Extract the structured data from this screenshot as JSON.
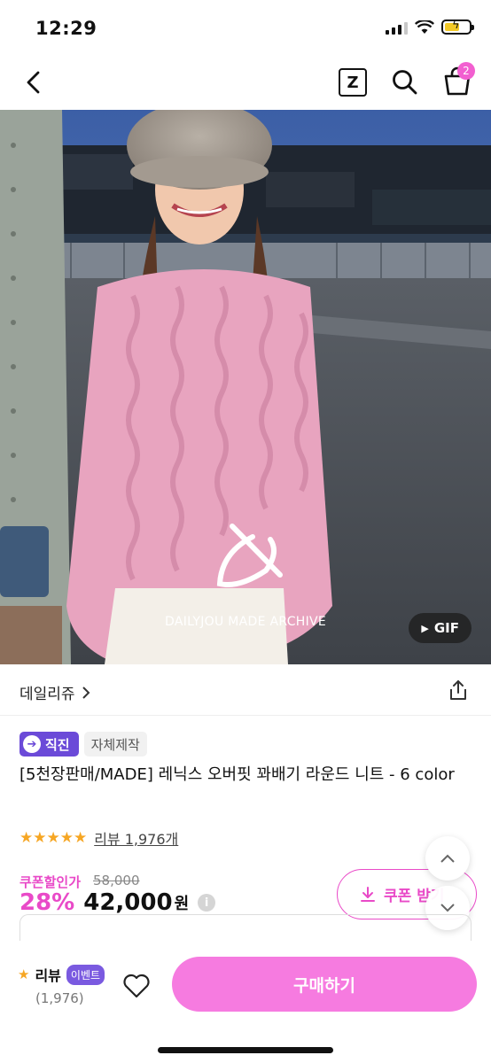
{
  "status_bar": {
    "time": "12:29"
  },
  "nav": {
    "z_label": "Z",
    "cart_count": "2"
  },
  "hero": {
    "watermark": "DAILYJOU MADE ARCHIVE",
    "gif_label": "GIF"
  },
  "product": {
    "brand": "데일리쥬",
    "tag_direct": "직진",
    "tag_made": "자체제작",
    "title": "[5천장판매/MADE] 레닉스 오버핏 꽈배기 라운드 니트 - 6 color",
    "stars": "★★★★★",
    "review_link": "리뷰 1,976개",
    "coupon_label": "쿠폰할인가",
    "original_price": "58,000",
    "discount": "28%",
    "price": "42,000",
    "currency": "원",
    "coupon_button": "쿠폰 받기"
  },
  "bottom": {
    "review_label": "리뷰",
    "event_badge": "이벤트",
    "review_count": "(1,976)",
    "buy_label": "구매하기"
  },
  "colors": {
    "accent": "#e94ac8",
    "buy": "#f67be0",
    "direct_tag": "#6b4ad8",
    "star": "#f6a623"
  }
}
